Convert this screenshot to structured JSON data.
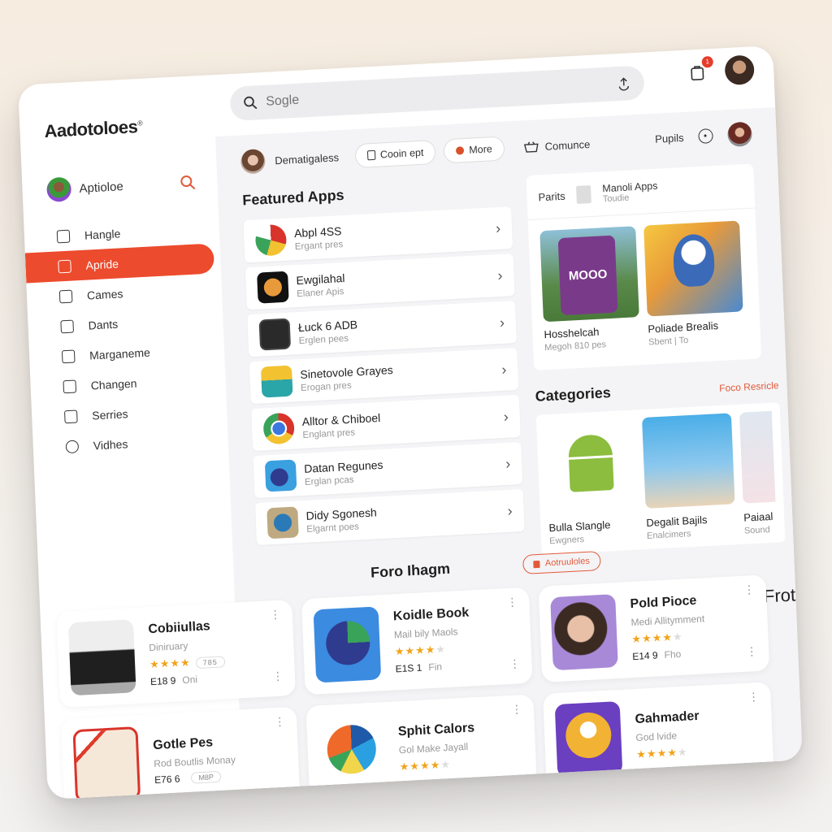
{
  "app": {
    "logo": "Aadotoloes",
    "logo_mark": "®"
  },
  "topbar": {
    "search_placeholder": "Sogle",
    "search_icon": "search-icon",
    "upload_icon": "upload-icon",
    "notifications_icon": "bag-icon",
    "notification_badge": "1"
  },
  "sidebar": {
    "profile_name": "Aptioloe",
    "items": [
      {
        "label": "Hangle",
        "icon": "basket-icon",
        "active": false
      },
      {
        "label": "Apride",
        "icon": "phone-icon",
        "active": true
      },
      {
        "label": "Cames",
        "icon": "gamepad-icon",
        "active": false
      },
      {
        "label": "Dants",
        "icon": "briefcase-icon",
        "active": false
      },
      {
        "label": "Marganeme",
        "icon": "folder-icon",
        "active": false
      },
      {
        "label": "Changen",
        "icon": "lock-icon",
        "active": false
      },
      {
        "label": "Serries",
        "icon": "print-icon",
        "active": false
      },
      {
        "label": "Vidhes",
        "icon": "play-icon",
        "active": false
      }
    ]
  },
  "subheader": {
    "user_label": "Dematigaless",
    "chip_coupon": "Cooin ept",
    "chip_more": "More",
    "commerce_link": "Comunce",
    "pupils_link": "Pupils"
  },
  "featured": {
    "title": "Featured Apps",
    "items": [
      {
        "name": "Abpl 4SS",
        "subtitle": "Ergant pres",
        "color": "#e8e8e8"
      },
      {
        "name": "Ewgilahal",
        "subtitle": "Elaner Apis",
        "color": "#111111"
      },
      {
        "name": "Łuck 6 ADB",
        "subtitle": "Erglen pees",
        "color": "#2a2a2a"
      },
      {
        "name": "Sinetovole Grayes",
        "subtitle": "Erogan pres",
        "color": "#2aa5a8"
      },
      {
        "name": "Alltor & Chiboel",
        "subtitle": "Englant pres",
        "color": "#ffffff"
      },
      {
        "name": "Datan Regunes",
        "subtitle": "Erglan pcas",
        "color": "#3aa0e0"
      },
      {
        "name": "Didy Sgonesh",
        "subtitle": "Elgarnt poes",
        "color": "#bfa980"
      }
    ]
  },
  "promo": {
    "label": "Parits",
    "app_name": "Manoli Apps",
    "app_sub": "Toudie",
    "cards": [
      {
        "title": "Hosshelcah",
        "subtitle": "Megoh 810 pes",
        "image_text": "MOOO"
      },
      {
        "title": "Poliade Brealis",
        "subtitle": "Sbent | To"
      }
    ]
  },
  "categories": {
    "title": "Categories",
    "see_all": "Foco Resricle",
    "items": [
      {
        "title": "Bulla Slangle",
        "subtitle": "Ewgners"
      },
      {
        "title": "Degalit Bajils",
        "subtitle": "Enalcimers"
      },
      {
        "title": "Paiaal",
        "subtitle": "Sound"
      }
    ]
  },
  "section_partial_title": "Frotu",
  "bottom": {
    "title": "Foro Ihagm",
    "pill_label": "Aotruuloles",
    "cards": [
      {
        "name": "Cobiiullas",
        "subtitle": "Diniruary",
        "rating": 4,
        "count": "785",
        "meta": "E18 9",
        "meta_sub": "Oni"
      },
      {
        "name": "Koidle Book",
        "subtitle": "Mail bily Maols",
        "rating": 3.5,
        "meta": "E1S 1",
        "meta_sub": "Fin"
      },
      {
        "name": "Pold Pioce",
        "subtitle": "Medi Allitymment",
        "rating": 3.5,
        "meta": "E14 9",
        "meta_sub": "Fho"
      },
      {
        "name": "Gotle Pes",
        "subtitle": "Rod Boutlis Monay",
        "meta": "E76 6",
        "count": "M8P"
      },
      {
        "name": "Sphit Calors",
        "subtitle": "Gol Make Jayall",
        "rating": 4
      },
      {
        "name": "Gahmader",
        "subtitle": "God lvide",
        "rating": 4
      }
    ]
  },
  "colors": {
    "accent": "#ec4b2d",
    "star": "#f2a31b",
    "background": "#f4f4f6"
  }
}
